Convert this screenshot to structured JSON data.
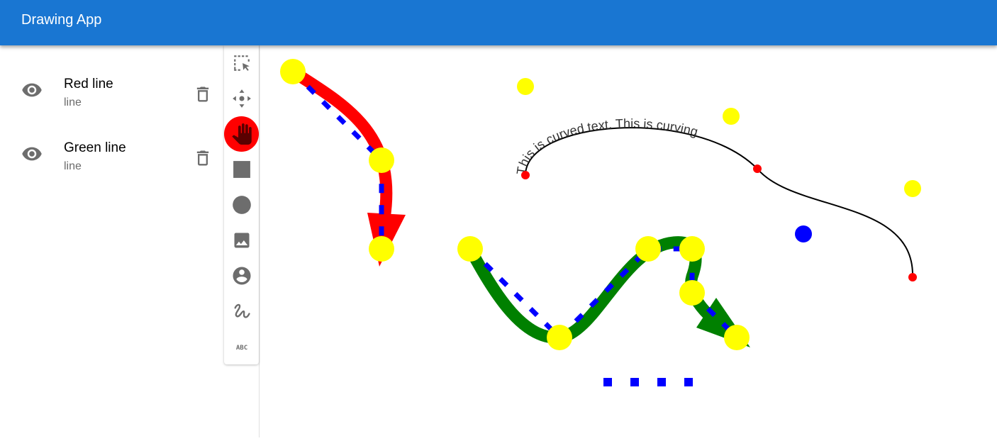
{
  "app": {
    "title": "Drawing App"
  },
  "layers": [
    {
      "name": "Red line",
      "type": "line",
      "visibility_icon": "eye-icon",
      "delete_icon": "trash-icon"
    },
    {
      "name": "Green line",
      "type": "line",
      "visibility_icon": "eye-icon",
      "delete_icon": "trash-icon"
    }
  ],
  "toolbar": {
    "tools": [
      {
        "name": "select",
        "icon": "select-area-icon"
      },
      {
        "name": "move",
        "icon": "move-icon"
      },
      {
        "name": "pan",
        "icon": "hand-icon",
        "active": true
      },
      {
        "name": "rectangle",
        "icon": "square-icon"
      },
      {
        "name": "circle",
        "icon": "circle-icon"
      },
      {
        "name": "image",
        "icon": "image-icon"
      },
      {
        "name": "avatar",
        "icon": "account-circle-icon"
      },
      {
        "name": "freehand",
        "icon": "gesture-icon"
      },
      {
        "name": "text",
        "icon": "abc-text-icon",
        "glyph": "ABC"
      }
    ]
  },
  "canvas": {
    "curved_text": "This is curved text. This is curving",
    "colors": {
      "red_line": "#ff0000",
      "green_line": "#008000",
      "guide": "#0000ff",
      "handle": "#ffff00",
      "anchor": "#ff0000",
      "text_path": "#000000"
    }
  },
  "colors": {
    "app_bar": "#1976d2",
    "icon_gray": "#6d6d6d",
    "active_tool": "#ff0000"
  }
}
